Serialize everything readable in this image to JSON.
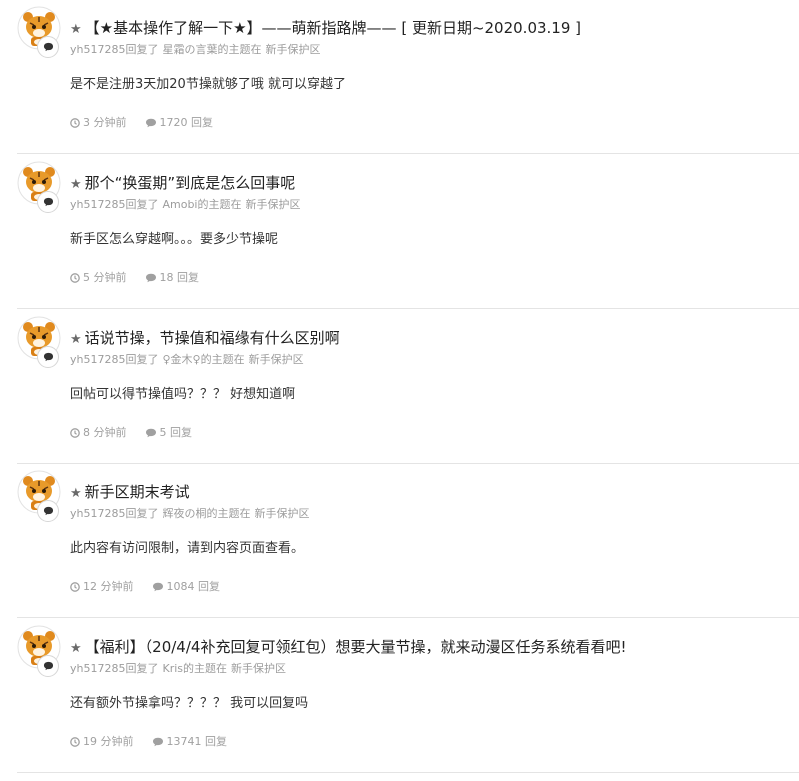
{
  "posts": [
    {
      "title": "【★基本操作了解一下★】——萌新指路牌—— [ 更新日期~2020.03.19 ]",
      "user": "yh517285",
      "action": "回复了",
      "author": "星霜の言葉",
      "topic_suffix": "的主题在",
      "forum": "新手保护区",
      "content": "是不是注册3天加20节操就够了哦 就可以穿越了",
      "time": "3 分钟前",
      "replies": "1720 回复"
    },
    {
      "title": "那个“换蛋期”到底是怎么回事呢",
      "user": "yh517285",
      "action": "回复了",
      "author": "Amobi",
      "topic_suffix": "的主题在",
      "forum": "新手保护区",
      "content": "新手区怎么穿越啊。。。要多少节操呢",
      "time": "5 分钟前",
      "replies": "18 回复"
    },
    {
      "title": "话说节操，节操值和福缘有什么区别啊",
      "user": "yh517285",
      "action": "回复了",
      "author": "♀金木♀",
      "topic_suffix": "的主题在",
      "forum": "新手保护区",
      "content": "回帖可以得节操值吗？？？ 好想知道啊",
      "time": "8 分钟前",
      "replies": "5 回复"
    },
    {
      "title": "新手区期末考试",
      "user": "yh517285",
      "action": "回复了",
      "author": "辉夜の桐",
      "topic_suffix": "的主题在",
      "forum": "新手保护区",
      "content": "此内容有访问限制，请到内容页面查看。",
      "time": "12 分钟前",
      "replies": "1084 回复"
    },
    {
      "title": "【福利】（20/4/4补充回复可领红包）想要大量节操，就来动漫区任务系统看看吧!",
      "user": "yh517285",
      "action": "回复了",
      "author": "Kris",
      "topic_suffix": "的主题在",
      "forum": "新手保护区",
      "content": "还有额外节操拿吗？？？？ 我可以回复吗",
      "time": "19 分钟前",
      "replies": "13741 回复"
    }
  ],
  "icons": {
    "star": "star-icon",
    "clock": "clock-icon",
    "comment": "comment-icon",
    "avatar": "tiger-avatar"
  },
  "colors": {
    "title": "#222222",
    "muted": "#9c9c9c",
    "divider": "#e4e4e4",
    "avatar_fur": "#e08a1e"
  }
}
